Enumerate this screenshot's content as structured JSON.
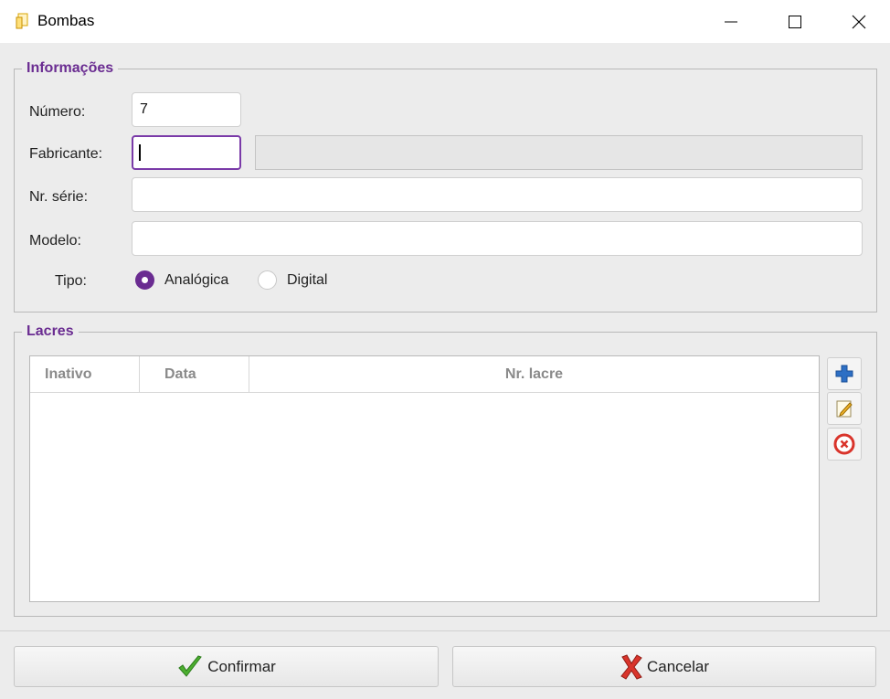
{
  "window": {
    "title": "Bombas",
    "app_icon": "document-icon",
    "controls": [
      "minimize-icon",
      "maximize-icon",
      "close-icon"
    ]
  },
  "informacoes": {
    "title": "Informações",
    "numero": {
      "label": "Número:",
      "value": "7"
    },
    "fabricante": {
      "label": "Fabricante:",
      "code_value": "",
      "name_value": ""
    },
    "nr_serie": {
      "label": "Nr. série:",
      "value": ""
    },
    "modelo": {
      "label": "Modelo:",
      "value": ""
    },
    "tipo": {
      "label": "Tipo:",
      "options": [
        "Analógica",
        "Digital"
      ],
      "selected": "Analógica"
    }
  },
  "lacres": {
    "title": "Lacres",
    "columns": [
      "Inativo",
      "Data",
      "Nr. lacre"
    ],
    "rows": [],
    "actions": [
      "add-icon",
      "edit-icon",
      "delete-icon"
    ]
  },
  "footer": {
    "confirm_label": "Confirmar",
    "cancel_label": "Cancelar"
  },
  "colors": {
    "accent": "#6a2c91",
    "confirm_icon": "#4caf2f",
    "cancel_icon": "#d9342b",
    "add_icon": "#2d6fc4"
  }
}
